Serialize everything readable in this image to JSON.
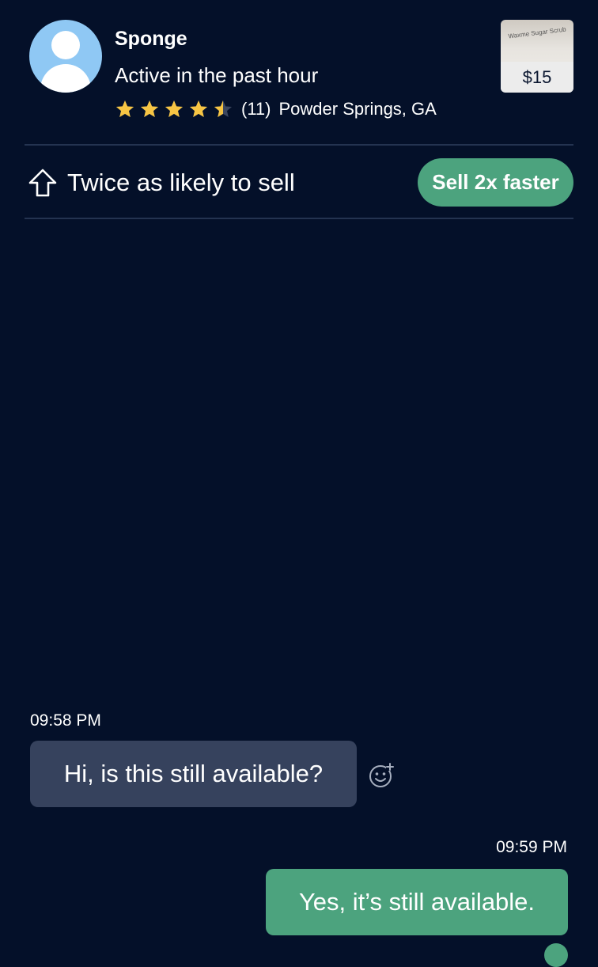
{
  "seller": {
    "name": "Sponge",
    "status": "Active in the past hour",
    "rating": 4.5,
    "rating_max": 5,
    "review_count": "(11)",
    "location": "Powder Springs, GA",
    "avatar_icon": "default-user-avatar-icon"
  },
  "listing": {
    "thumbnail_label": "Waxme Sugar Scrub",
    "price": "$15"
  },
  "promo": {
    "icon": "arrow-up-outline-icon",
    "text": "Twice as likely to sell",
    "button_label": "Sell 2x faster"
  },
  "messages": [
    {
      "time": "09:58 PM",
      "text": "Hi, is this still available?",
      "direction": "incoming"
    },
    {
      "time": "09:59 PM",
      "text": "Yes, it’s still available.",
      "direction": "outgoing"
    }
  ],
  "colors": {
    "background": "#041029",
    "accent_green": "#4ca37e",
    "star_filled": "#f7c544",
    "star_empty": "#3c475f",
    "incoming_bubble": "#36425d",
    "divider": "#243350"
  }
}
